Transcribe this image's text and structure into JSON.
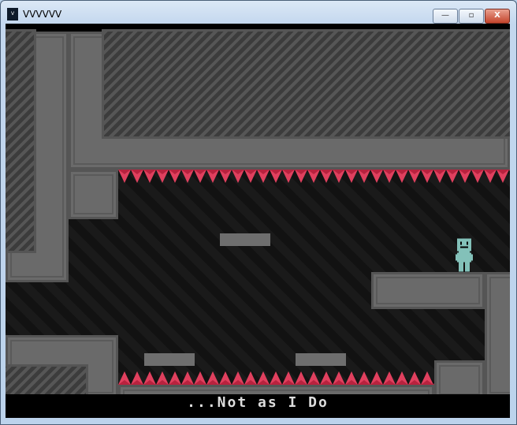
{
  "window": {
    "title": "VVVVVV",
    "minimize_label": "—",
    "maximize_label": "▫",
    "close_label": "X"
  },
  "game": {
    "room_name": "...Not as I Do"
  },
  "colors": {
    "spike": "#e0405e",
    "player": "#83c1b9",
    "wall": "#6a6a6a"
  }
}
